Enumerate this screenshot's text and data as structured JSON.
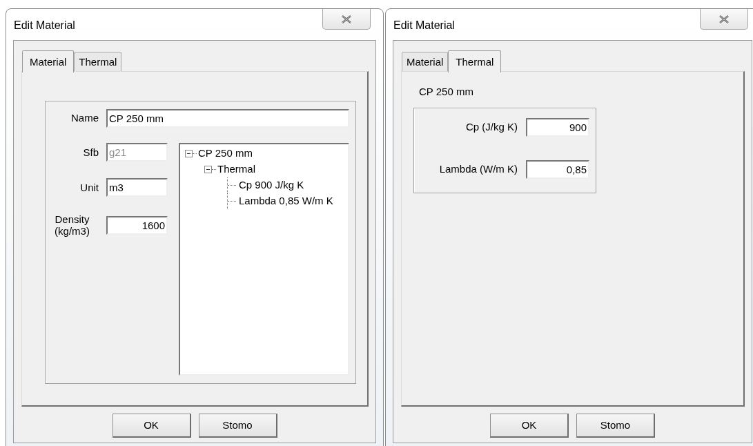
{
  "dialogs": [
    {
      "kind": "material",
      "title": "Edit Material",
      "tabs": [
        {
          "label": "Material",
          "selected": true
        },
        {
          "label": "Thermal",
          "selected": false
        }
      ],
      "name_field": {
        "label": "Name",
        "value": "CP 250 mm",
        "disabled": false
      },
      "fields": [
        {
          "label": "Sfb",
          "value": "g21",
          "disabled": true,
          "kind": "text"
        },
        {
          "label": "Unit",
          "value": "m3",
          "disabled": false,
          "kind": "text"
        },
        {
          "label": "Density (kg/m3)",
          "value": "1600",
          "disabled": false,
          "kind": "number"
        }
      ],
      "tree": [
        {
          "label": "CP 250 mm",
          "expanded": true,
          "children": [
            {
              "label": "Thermal",
              "expanded": true,
              "children": [
                {
                  "label": "Cp 900 J/kg K"
                },
                {
                  "label": "Lambda 0,85 W/m K"
                }
              ]
            }
          ]
        }
      ],
      "buttons": [
        "OK",
        "Stomo"
      ]
    },
    {
      "kind": "thermal",
      "title": "Edit Material",
      "tabs": [
        {
          "label": "Material",
          "selected": false
        },
        {
          "label": "Thermal",
          "selected": true
        }
      ],
      "caption": "CP 250 mm",
      "fields": [
        {
          "label": "Cp (J/kg K)",
          "value": "900",
          "disabled": false,
          "kind": "number"
        },
        {
          "label": "Lambda (W/m K)",
          "value": "0,85",
          "disabled": false,
          "kind": "number"
        }
      ],
      "buttons": [
        "OK",
        "Stomo"
      ]
    }
  ]
}
